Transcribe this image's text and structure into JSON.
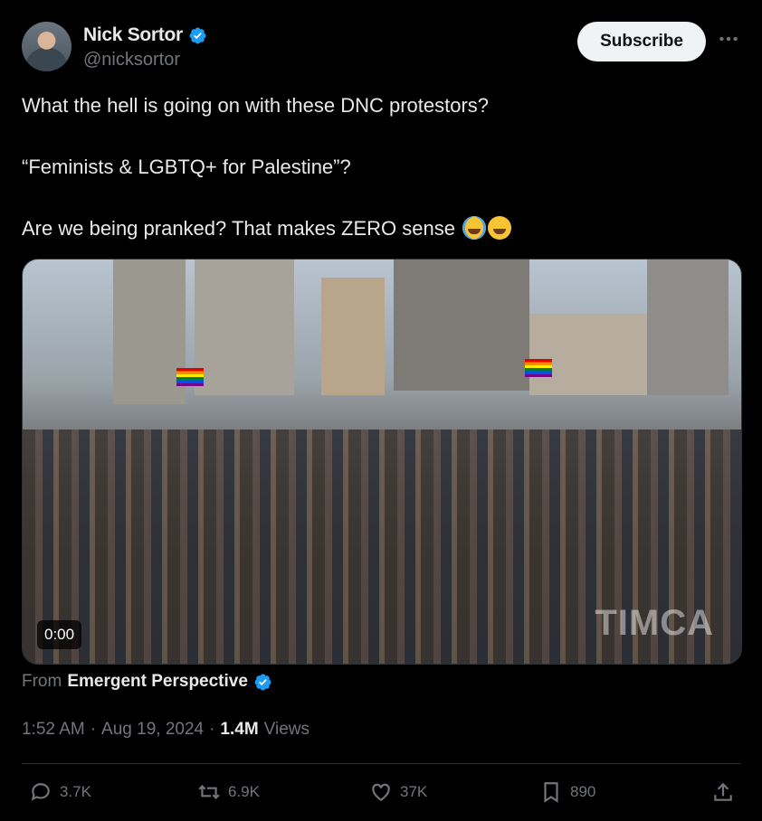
{
  "author": {
    "display_name": "Nick Sortor",
    "handle": "@nicksortor",
    "verified_icon": "verified-badge-icon"
  },
  "header": {
    "subscribe_label": "Subscribe",
    "more_icon": "more-horizontal-icon"
  },
  "tweet": {
    "line1": "What the hell is going on with these DNC protestors?",
    "line2": "“Feminists & LGBTQ+ for Palestine”?",
    "line3": "Are we being pranked? That makes ZERO sense",
    "emojis": [
      "face-with-tears-of-joy",
      "rolling-on-floor-laughing"
    ]
  },
  "media": {
    "type": "video",
    "duration": "0:00",
    "watermark": "TIMCA"
  },
  "attribution": {
    "prefix": "From",
    "source": "Emergent Perspective"
  },
  "meta": {
    "time": "1:52 AM",
    "sep1": "·",
    "date": "Aug 19, 2024",
    "sep2": "·",
    "views_count": "1.4M",
    "views_label": "Views"
  },
  "actions": {
    "replies": "3.7K",
    "reposts": "6.9K",
    "likes": "37K",
    "bookmarks": "890"
  },
  "colors": {
    "background": "#000000",
    "text": "#e7e9ea",
    "muted": "#71767b",
    "verified": "#1d9bf0",
    "subscribe_bg": "#eff3f4"
  }
}
